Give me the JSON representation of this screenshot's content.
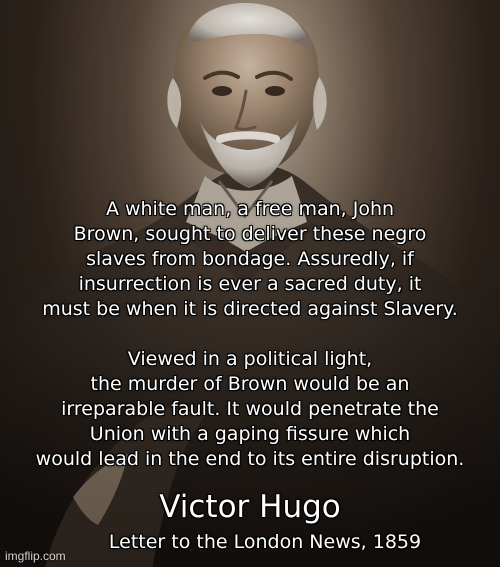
{
  "quote": {
    "first": "A white man, a free man, John\nBrown, sought to deliver these negro\nslaves from bondage. Assuredly, if\ninsurrection is ever a sacred duty, it\nmust be when it is directed against Slavery.",
    "second": "Viewed in a political light,\nthe murder of Brown would be an\nirreparable fault. It would penetrate the\nUnion with a gaping fissure which\nwould lead in the end to its entire disruption."
  },
  "attribution": {
    "author": "Victor Hugo",
    "source": "Letter to the London News, 1859"
  },
  "watermark": "imgflip.com",
  "colors": {
    "text": "#ffffff",
    "outline": "#000000",
    "sepia_light": "#d8cdbd",
    "sepia_dark": "#181410"
  }
}
